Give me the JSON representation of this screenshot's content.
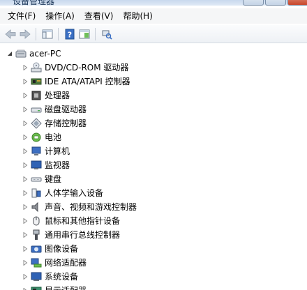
{
  "menu": [
    "文件(F)",
    "操作(A)",
    "查看(V)",
    "帮助(H)"
  ],
  "root": {
    "label": "acer-PC",
    "icon": "computer-icon"
  },
  "categories": [
    {
      "label": "DVD/CD-ROM 驱动器",
      "icon": "optical-drive-icon"
    },
    {
      "label": "IDE ATA/ATAPI 控制器",
      "icon": "ide-controller-icon"
    },
    {
      "label": "处理器",
      "icon": "processor-icon"
    },
    {
      "label": "磁盘驱动器",
      "icon": "disk-drive-icon"
    },
    {
      "label": "存储控制器",
      "icon": "storage-controller-icon"
    },
    {
      "label": "电池",
      "icon": "battery-icon"
    },
    {
      "label": "计算机",
      "icon": "computer-icon"
    },
    {
      "label": "监视器",
      "icon": "monitor-icon"
    },
    {
      "label": "键盘",
      "icon": "keyboard-icon"
    },
    {
      "label": "人体学输入设备",
      "icon": "hid-icon"
    },
    {
      "label": "声音、视频和游戏控制器",
      "icon": "speaker-icon"
    },
    {
      "label": "鼠标和其他指针设备",
      "icon": "mouse-icon"
    },
    {
      "label": "通用串行总线控制器",
      "icon": "usb-icon"
    },
    {
      "label": "图像设备",
      "icon": "camera-icon"
    },
    {
      "label": "网络适配器",
      "icon": "network-adapter-icon"
    },
    {
      "label": "系统设备",
      "icon": "system-devices-icon"
    },
    {
      "label": "显示适配器",
      "icon": "display-adapter-icon"
    }
  ]
}
